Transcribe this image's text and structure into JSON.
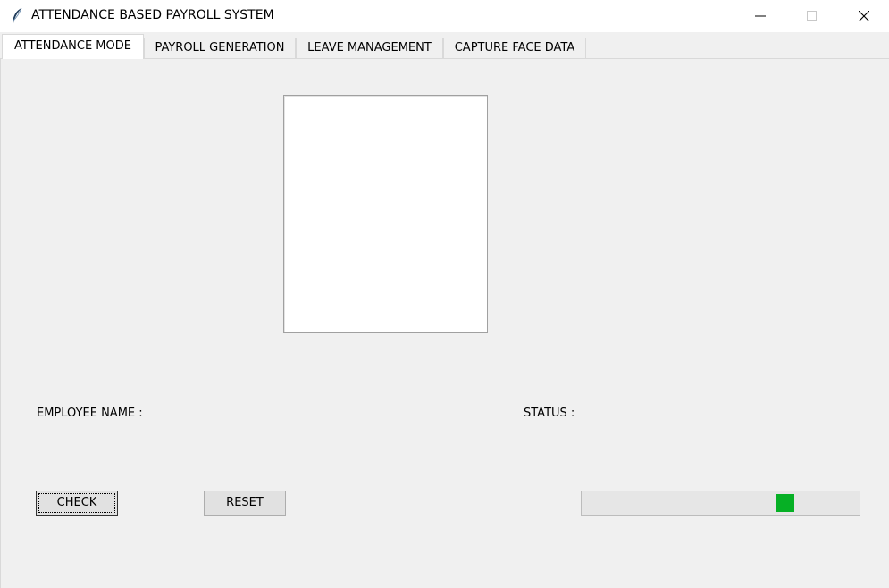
{
  "window": {
    "title": "ATTENDANCE BASED PAYROLL SYSTEM",
    "icon": "feather-icon",
    "controls": [
      "minimize-icon",
      "maximize-icon",
      "close-icon"
    ]
  },
  "tabs": [
    {
      "label": "ATTENDANCE MODE",
      "active": true
    },
    {
      "label": "PAYROLL GENERATION",
      "active": false
    },
    {
      "label": "LEAVE MANAGEMENT",
      "active": false
    },
    {
      "label": "CAPTURE FACE DATA",
      "active": false
    }
  ],
  "attendance": {
    "employee_name_label": "EMPLOYEE NAME :",
    "status_label": "STATUS :",
    "check_label": "CHECK",
    "reset_label": "RESET",
    "progress": {
      "mode": "indeterminate",
      "indicator_position": 0.75,
      "color": "#06b025"
    }
  }
}
